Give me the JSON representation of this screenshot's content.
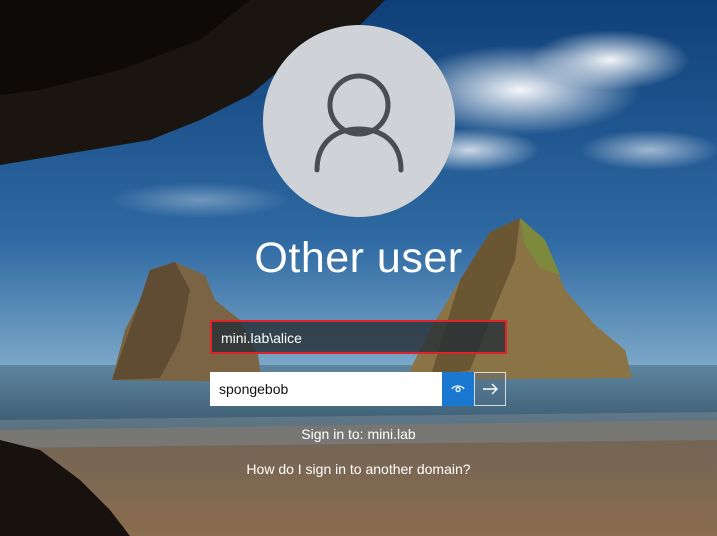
{
  "login": {
    "title": "Other user",
    "username_value": "mini.lab\\alice",
    "password_value": "spongebob",
    "sign_in_to": "Sign in to: mini.lab",
    "help_link": "How do I sign in to another domain?"
  },
  "icons": {
    "avatar": "user-silhouette-icon",
    "reveal": "eye-icon",
    "submit": "arrow-right-icon"
  },
  "colors": {
    "highlight_border": "#e0222a",
    "reveal_button": "#1a78d0",
    "avatar_circle": "#cfd3d8"
  }
}
